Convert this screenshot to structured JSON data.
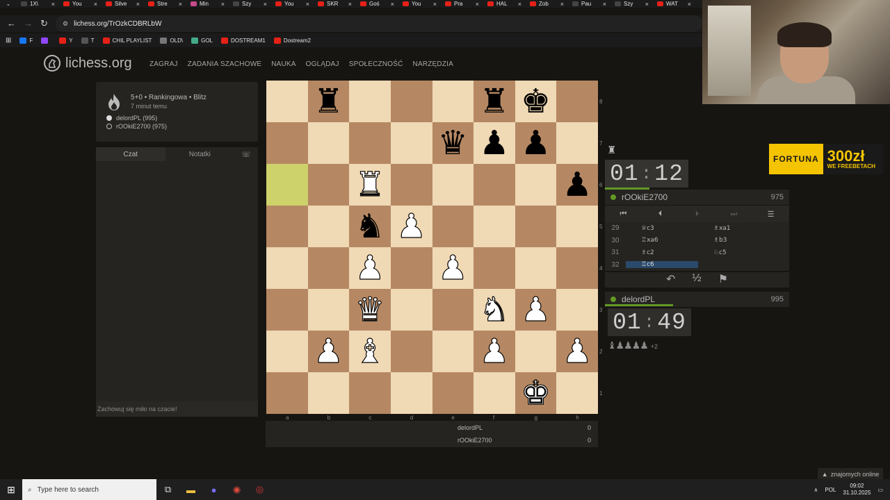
{
  "browser": {
    "tabs": [
      {
        "label": "1X\\",
        "color": "#444"
      },
      {
        "label": "You",
        "color": "#e62117"
      },
      {
        "label": "Silve",
        "color": "#e62117"
      },
      {
        "label": "Stre",
        "color": "#e62117"
      },
      {
        "label": "Min",
        "color": "#c64b8c"
      },
      {
        "label": "Szy",
        "color": "#444"
      },
      {
        "label": "You",
        "color": "#e62117"
      },
      {
        "label": "SKR",
        "color": "#e62117"
      },
      {
        "label": "Goś",
        "color": "#e62117"
      },
      {
        "label": "You",
        "color": "#e62117"
      },
      {
        "label": "Pra",
        "color": "#e62117"
      },
      {
        "label": "HAL",
        "color": "#e62117"
      },
      {
        "label": "Zob",
        "color": "#e62117"
      },
      {
        "label": "Pau",
        "color": "#444"
      },
      {
        "label": "Szy",
        "color": "#444"
      },
      {
        "label": "WAT",
        "color": "#e62117"
      }
    ],
    "url": "lichess.org/TrOzkCDBRLbW",
    "bookmarks": [
      {
        "label": "F",
        "color": "#1877f2"
      },
      {
        "label": "",
        "color": "#9147ff"
      },
      {
        "label": "Y",
        "color": "#e62117"
      },
      {
        "label": "T",
        "color": "#555"
      },
      {
        "label": "CHIL PLAYLIST",
        "color": "#e62117"
      },
      {
        "label": "OLD\\",
        "color": "#777"
      },
      {
        "label": "GOL",
        "color": "#4a8"
      },
      {
        "label": "DOSTREAM1",
        "color": "#e62117"
      },
      {
        "label": "Dostream2",
        "color": "#e62117"
      }
    ]
  },
  "site": {
    "logo": "lichess.org",
    "nav": [
      "ZAGRAJ",
      "ZADANIA SZACHOWE",
      "NAUKA",
      "OGLĄDAJ",
      "SPOŁECZNOŚĆ",
      "NARZĘDZIA"
    ]
  },
  "game_info": {
    "title": "5+0 • Rankingowa • Blitz",
    "subtitle": "7 minut temu",
    "white_player": "delordPL (995)",
    "black_player": "rOOkiE2700 (975)"
  },
  "chat": {
    "tab_chat": "Czat",
    "tab_notes": "Notatki",
    "placeholder": "Zachowuj się miło na czacie!"
  },
  "board": {
    "files": [
      "a",
      "b",
      "c",
      "d",
      "e",
      "f",
      "g",
      "h"
    ],
    "ranks": [
      "8",
      "7",
      "6",
      "5",
      "4",
      "3",
      "2",
      "1"
    ],
    "position": [
      [
        "",
        "r",
        "",
        "",
        "",
        "r",
        "k",
        ""
      ],
      [
        "",
        "",
        "",
        "",
        "q",
        "p",
        "p",
        ""
      ],
      [
        "",
        "",
        "R",
        "",
        "",
        "",
        "",
        "p"
      ],
      [
        "",
        "",
        "n",
        "P",
        "",
        "",
        "",
        ""
      ],
      [
        "",
        "",
        "P",
        "",
        "P",
        "",
        "",
        ""
      ],
      [
        "",
        "",
        "Q",
        "",
        "",
        "N",
        "P",
        ""
      ],
      [
        "",
        "P",
        "B",
        "",
        "",
        "P",
        "",
        "P"
      ],
      [
        "",
        "",
        "",
        "",
        "",
        "",
        "K",
        ""
      ]
    ],
    "highlight": [
      "a6",
      "c6"
    ]
  },
  "score": {
    "rows": [
      {
        "name": "delordPL",
        "value": "0"
      },
      {
        "name": "rOOkiE2700",
        "value": "0"
      }
    ]
  },
  "right_panel": {
    "top_clock": {
      "min": "01",
      "sec": "12"
    },
    "top_player": {
      "name": "rOOkiE2700",
      "rating": "975"
    },
    "bottom_clock": {
      "min": "01",
      "sec": "49"
    },
    "bottom_player": {
      "name": "delordPL",
      "rating": "995"
    },
    "moves": [
      {
        "num": "29",
        "white": "♕c3",
        "black": "♗xa1"
      },
      {
        "num": "30",
        "white": "♖xa6",
        "black": "♗b3"
      },
      {
        "num": "31",
        "white": "♗c2",
        "black": "♘c5"
      },
      {
        "num": "32",
        "white": "♖c6",
        "black": ""
      }
    ],
    "material_bonus": "+2"
  },
  "ad": {
    "brand": "FORTUNA",
    "amount": "300zł",
    "tagline": "WE FREEBETACH"
  },
  "friends": "znajomych online",
  "taskbar": {
    "search_placeholder": "Type here to search",
    "lang": "POL",
    "time": "09:02",
    "date": "31.10.2025"
  }
}
